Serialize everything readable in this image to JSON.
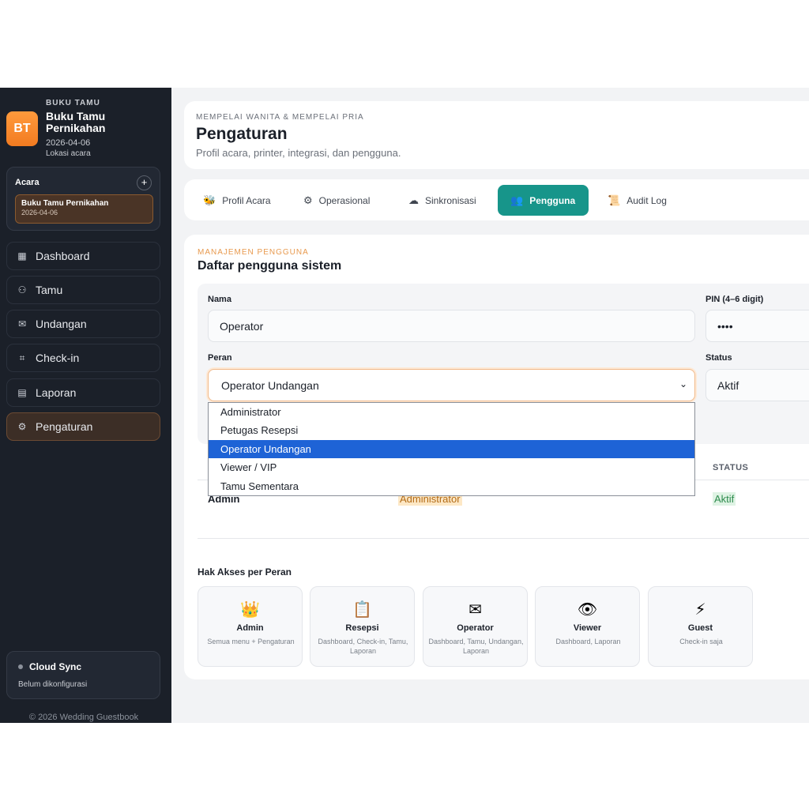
{
  "sidebar": {
    "brand": {
      "logo": "BT",
      "kicker": "BUKU TAMU",
      "title": "Buku Tamu Pernikahan",
      "date": "2026-04-06",
      "location": "Lokasi acara"
    },
    "event_section": {
      "label": "Acara",
      "add": "+",
      "item_name": "Buku Tamu Pernikahan",
      "item_date": "2026-04-06"
    },
    "nav": [
      {
        "label": "Dashboard",
        "icon": "grid-icon"
      },
      {
        "label": "Tamu",
        "icon": "users-icon"
      },
      {
        "label": "Undangan",
        "icon": "mail-icon"
      },
      {
        "label": "Check-in",
        "icon": "scan-icon"
      },
      {
        "label": "Laporan",
        "icon": "document-icon"
      },
      {
        "label": "Pengaturan",
        "icon": "gear-icon",
        "active": true
      }
    ],
    "sync": {
      "title": "Cloud Sync",
      "status": "Belum dikonfigurasi"
    },
    "copyright": "© 2026 Wedding Guestbook"
  },
  "header": {
    "kicker": "MEMPELAI WANITA & MEMPELAI PRIA",
    "title": "Pengaturan",
    "subtitle": "Profil acara, printer, integrasi, dan pengguna."
  },
  "tabs": [
    {
      "label": "Profil Acara",
      "icon": "bee-icon"
    },
    {
      "label": "Operasional",
      "icon": "gear-icon"
    },
    {
      "label": "Sinkronisasi",
      "icon": "cloud-icon"
    },
    {
      "label": "Pengguna",
      "icon": "users-icon",
      "active": true
    },
    {
      "label": "Audit Log",
      "icon": "scroll-icon"
    }
  ],
  "panel": {
    "kicker": "MANAJEMEN PENGGUNA",
    "title": "Daftar pengguna sistem",
    "form": {
      "name_label": "Nama",
      "name_value": "Operator",
      "pin_label": "PIN (4–6 digit)",
      "pin_value": "••••",
      "role_label": "Peran",
      "role_value": "Operator Undangan",
      "status_label": "Status",
      "status_value": "Aktif"
    },
    "role_options": [
      "Administrator",
      "Petugas Resepsi",
      "Operator Undangan",
      "Viewer / VIP",
      "Tamu Sementara"
    ],
    "table": {
      "status_header": "STATUS",
      "row": {
        "name": "Admin",
        "role": "Administrator",
        "status": "Aktif"
      }
    },
    "permissions": {
      "title": "Hak Akses per Peran",
      "cards": [
        {
          "icon": "crown-icon",
          "name": "Admin",
          "desc": "Semua menu + Pengaturan"
        },
        {
          "icon": "clipboard-icon",
          "name": "Resepsi",
          "desc": "Dashboard, Check-in, Tamu, Laporan"
        },
        {
          "icon": "envelope-icon",
          "name": "Operator",
          "desc": "Dashboard, Tamu, Undangan, Laporan"
        },
        {
          "icon": "eye-icon",
          "name": "Viewer",
          "desc": "Dashboard, Laporan"
        },
        {
          "icon": "lightning-icon",
          "name": "Guest",
          "desc": "Check-in saja"
        }
      ]
    }
  },
  "colors": {
    "sidebar_bg": "#1b2029",
    "accent_orange": "#f27b21",
    "active_tab": "#17958a",
    "dropdown_highlight": "#1e63d6"
  }
}
